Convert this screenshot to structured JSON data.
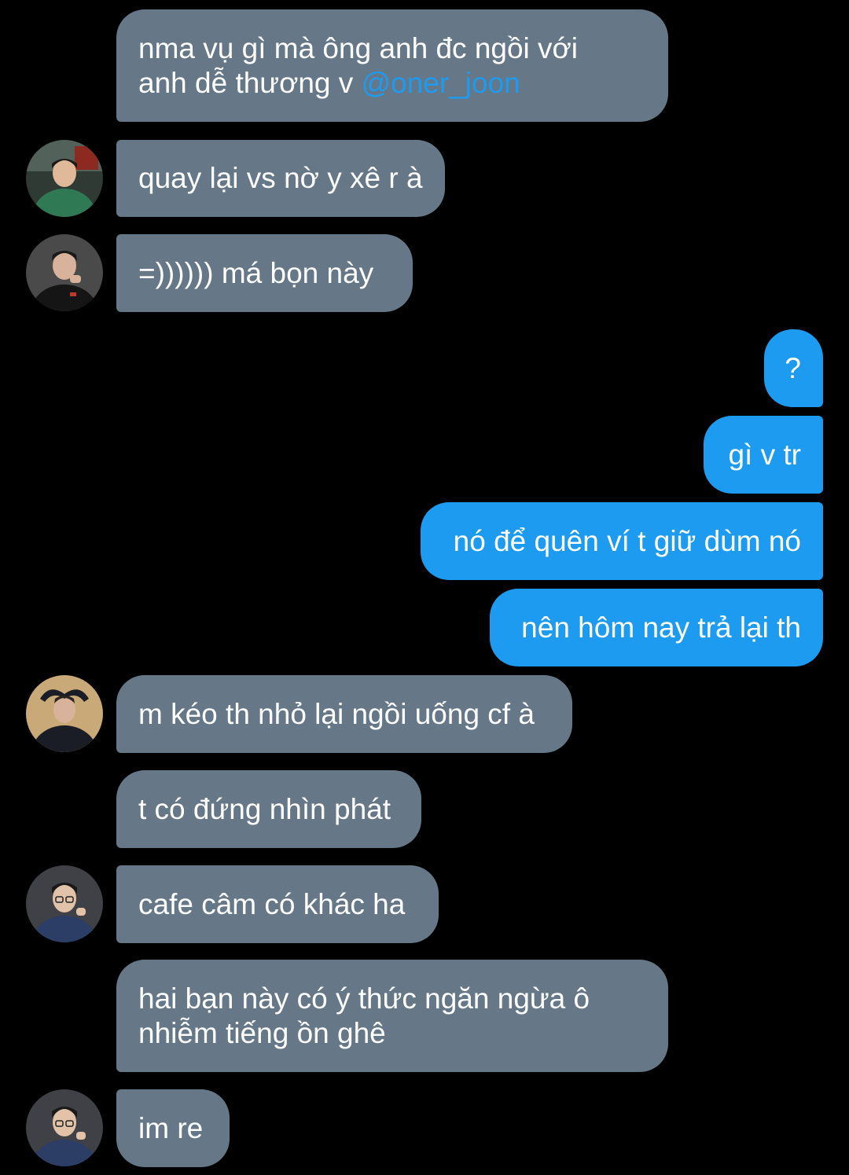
{
  "conversation": {
    "messages": [
      {
        "direction": "incoming",
        "text": "nma vụ gì mà ông anh đc ngồi với\nanh dễ thương v ",
        "mention": "@oner_joon"
      },
      {
        "direction": "incoming",
        "text": "quay lại vs nờ y xê r à",
        "avatar": "avatar-green-jacket"
      },
      {
        "direction": "incoming",
        "text": "=)))))) má bọn này",
        "avatar": "avatar-black-shirt"
      },
      {
        "direction": "outgoing",
        "text": "?"
      },
      {
        "direction": "outgoing",
        "text": "gì v tr"
      },
      {
        "direction": "outgoing",
        "text": "nó để quên ví t giữ dùm nó"
      },
      {
        "direction": "outgoing",
        "text": "nên hôm nay trả lại th"
      },
      {
        "direction": "incoming",
        "text": "m kéo th nhỏ lại ngồi uống cf à",
        "avatar": "avatar-hands-on-head"
      },
      {
        "direction": "incoming",
        "text": "t có đứng nhìn phát"
      },
      {
        "direction": "incoming",
        "text": "cafe câm có khác ha",
        "avatar": "avatar-glasses"
      },
      {
        "direction": "incoming",
        "text": "hai bạn này có ý thức ngăn ngừa ô\nnhiễm tiếng ồn ghê"
      },
      {
        "direction": "incoming",
        "text": "im re",
        "avatar": "avatar-glasses"
      }
    ]
  },
  "colors": {
    "background": "#000000",
    "incoming_bubble": "#667888",
    "outgoing_bubble": "#1d9bf0",
    "mention": "#1d9bf0",
    "text": "#ffffff"
  }
}
